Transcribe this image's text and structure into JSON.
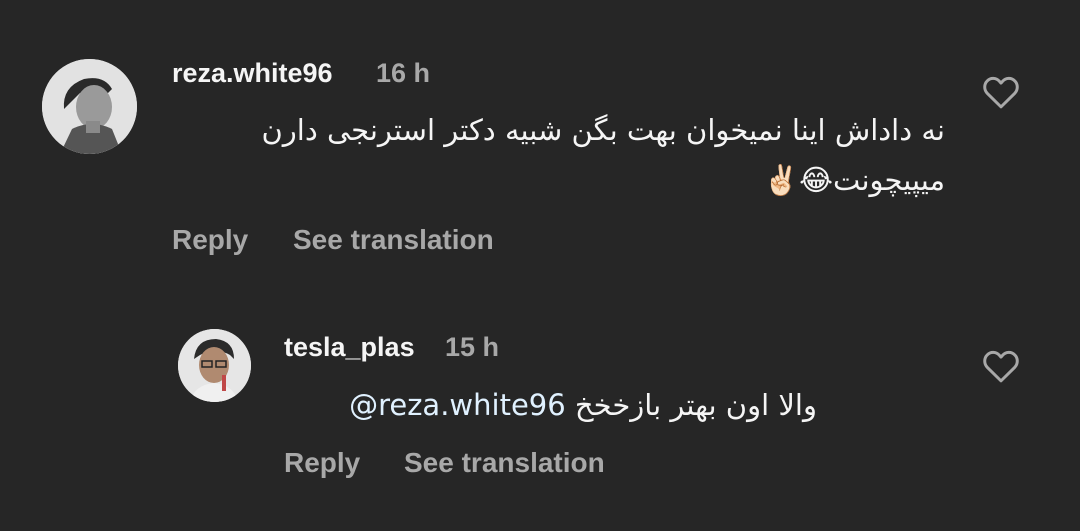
{
  "comments": [
    {
      "username": "reza.white96",
      "time": "16 h",
      "body_line1": "نه داداش اینا نمیخوان بهت بگن شبیه دکتر استرنجی دارن",
      "body_line2": "میپیچونت😂✌🏻",
      "reply_label": "Reply",
      "translate_label": "See translation",
      "like_icon": "heart-outline-icon"
    },
    {
      "username": "tesla_plas",
      "time": "15 h",
      "mention": "@reza.white96",
      "body": "والا اون بهتر بازخخخ",
      "reply_label": "Reply",
      "translate_label": "See translation",
      "like_icon": "heart-outline-icon"
    }
  ],
  "colors": {
    "background": "#262626",
    "primary_text": "#f5f5f5",
    "secondary_text": "#a8a8a8",
    "mention": "#e0f1ff"
  }
}
